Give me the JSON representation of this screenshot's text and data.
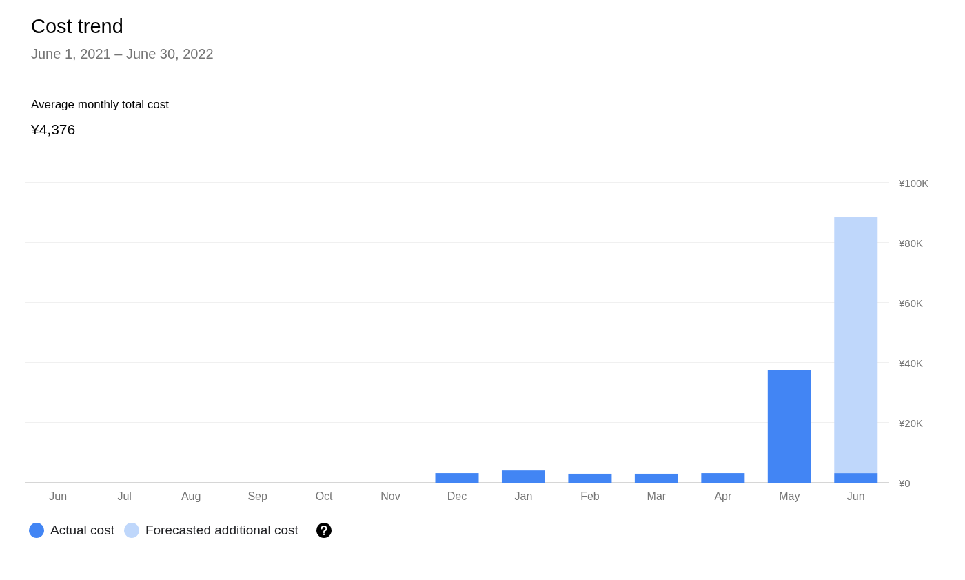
{
  "header": {
    "title": "Cost trend",
    "date_range": "June 1, 2021 – June 30, 2022"
  },
  "summary": {
    "label": "Average monthly total cost",
    "value": "¥4,376"
  },
  "chart": {
    "chart_data": {
      "type": "bar",
      "stacked": true,
      "grid": true,
      "categories": [
        "Jun",
        "Jul",
        "Aug",
        "Sep",
        "Oct",
        "Nov",
        "Dec",
        "Jan",
        "Feb",
        "Mar",
        "Apr",
        "May",
        "Jun"
      ],
      "ylim": [
        0,
        100000
      ],
      "yticks": [
        {
          "value": 0,
          "label": "¥0"
        },
        {
          "value": 20000,
          "label": "¥20K"
        },
        {
          "value": 40000,
          "label": "¥40K"
        },
        {
          "value": 60000,
          "label": "¥60K"
        },
        {
          "value": 80000,
          "label": "¥80K"
        },
        {
          "value": 100000,
          "label": "¥100K"
        }
      ],
      "series": [
        {
          "name": "Actual cost",
          "color": "#4285f4",
          "values": [
            0,
            0,
            0,
            0,
            0,
            0,
            3200,
            4100,
            3000,
            3000,
            3200,
            37500,
            3200
          ]
        },
        {
          "name": "Forecasted additional cost",
          "color": "#bfd7fb",
          "values": [
            0,
            0,
            0,
            0,
            0,
            0,
            0,
            0,
            0,
            0,
            0,
            0,
            85300
          ]
        }
      ]
    }
  }
}
